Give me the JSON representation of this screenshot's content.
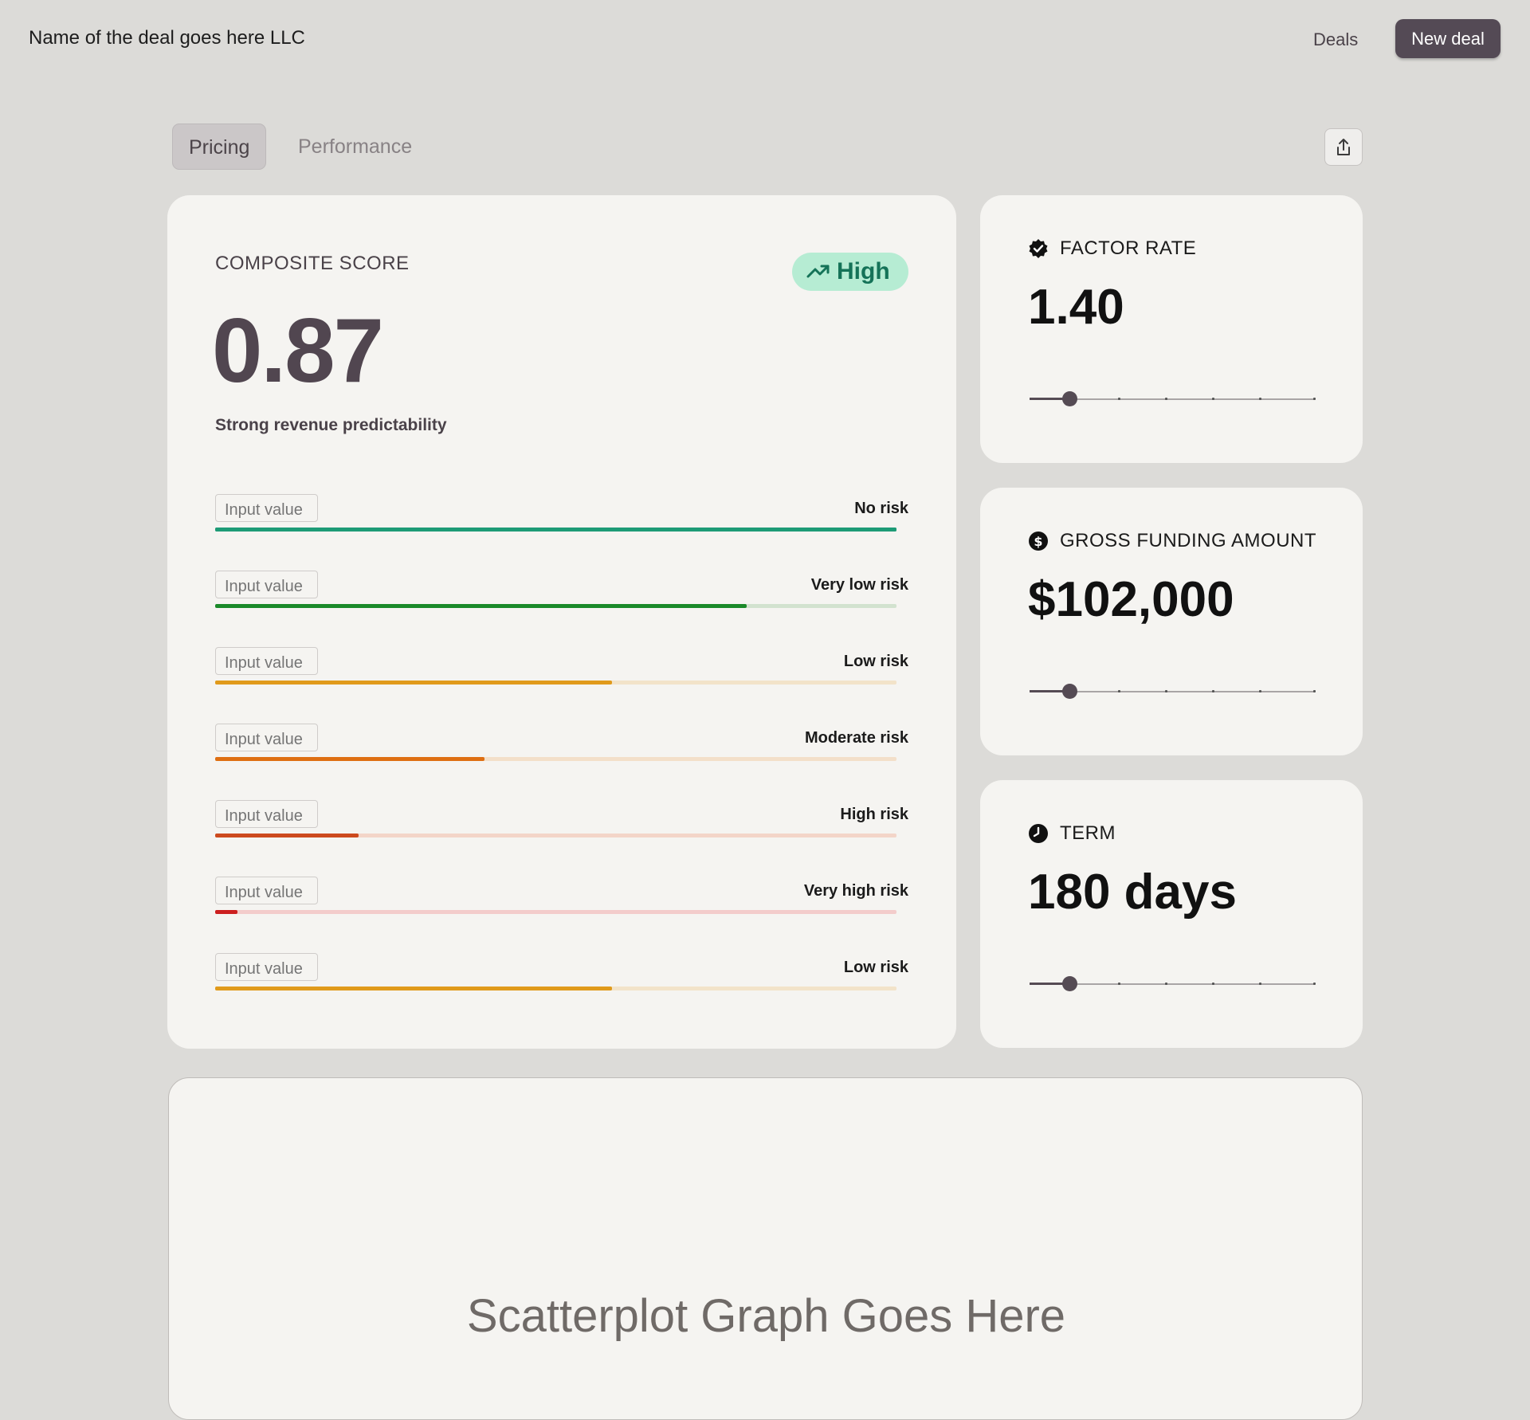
{
  "header": {
    "deal_name": "Name of the deal goes here LLC",
    "nav_deals": "Deals",
    "new_deal_button": "New deal"
  },
  "tabs": [
    {
      "label": "Pricing",
      "active": true
    },
    {
      "label": "Performance",
      "active": false
    }
  ],
  "composite": {
    "label": "COMPOSITE SCORE",
    "badge": "High",
    "score": "0.87",
    "description": "Strong revenue predictability",
    "rows": [
      {
        "input_placeholder": "Input value",
        "risk": "No risk",
        "fill": 1.0,
        "color": "#1d9b76",
        "track": "#1d9b76"
      },
      {
        "input_placeholder": "Input value",
        "risk": "Very low risk",
        "fill": 0.78,
        "color": "#1b8a2a",
        "track": "#d2e2cf"
      },
      {
        "input_placeholder": "Input value",
        "risk": "Low risk",
        "fill": 0.583,
        "color": "#e09a1b",
        "track": "#f2e3c9"
      },
      {
        "input_placeholder": "Input value",
        "risk": "Moderate risk",
        "fill": 0.395,
        "color": "#de6f12",
        "track": "#f3dfc9"
      },
      {
        "input_placeholder": "Input value",
        "risk": "High risk",
        "fill": 0.21,
        "color": "#cc4a1e",
        "track": "#f3d5c8"
      },
      {
        "input_placeholder": "Input value",
        "risk": "Very high risk",
        "fill": 0.033,
        "color": "#cc1f1f",
        "track": "#f3cccb"
      },
      {
        "input_placeholder": "Input value",
        "risk": "Low risk",
        "fill": 0.583,
        "color": "#e09a1b",
        "track": "#f2e3c9"
      }
    ]
  },
  "factor_rate": {
    "title": "FACTOR RATE",
    "value": "1.40",
    "level": 0.14
  },
  "gross_funding": {
    "title": "GROSS FUNDING AMOUNT",
    "value": "$102,000",
    "level": 0.14
  },
  "term": {
    "title": "TERM",
    "value": "180 days",
    "level": 0.14
  },
  "scatter": {
    "placeholder": "Scatterplot Graph Goes Here"
  },
  "colors": {
    "accent": "#554b54",
    "badge_bg": "#b6ecd3",
    "badge_fg": "#157358"
  }
}
